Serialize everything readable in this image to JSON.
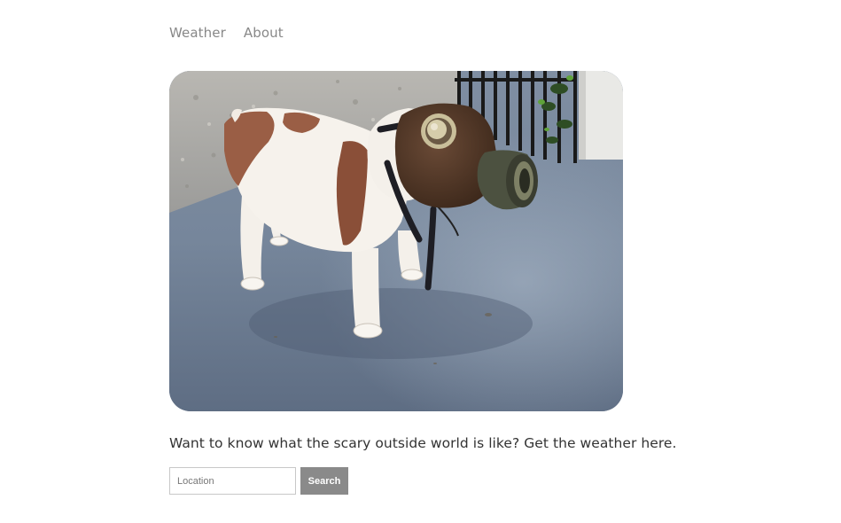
{
  "nav": {
    "items": [
      {
        "label": "Weather"
      },
      {
        "label": "About"
      }
    ]
  },
  "hero": {
    "image_alt": "Bulldog wearing a gas mask on a concrete porch"
  },
  "main": {
    "tagline": "Want to know what the scary outside world is like? Get the weather here."
  },
  "search": {
    "placeholder": "Location",
    "value": "",
    "button_label": "Search"
  },
  "colors": {
    "nav_link": "#888888",
    "text": "#333333",
    "button_bg": "#8a8a8a",
    "button_text": "#ffffff",
    "input_border": "#c8c8c8"
  }
}
